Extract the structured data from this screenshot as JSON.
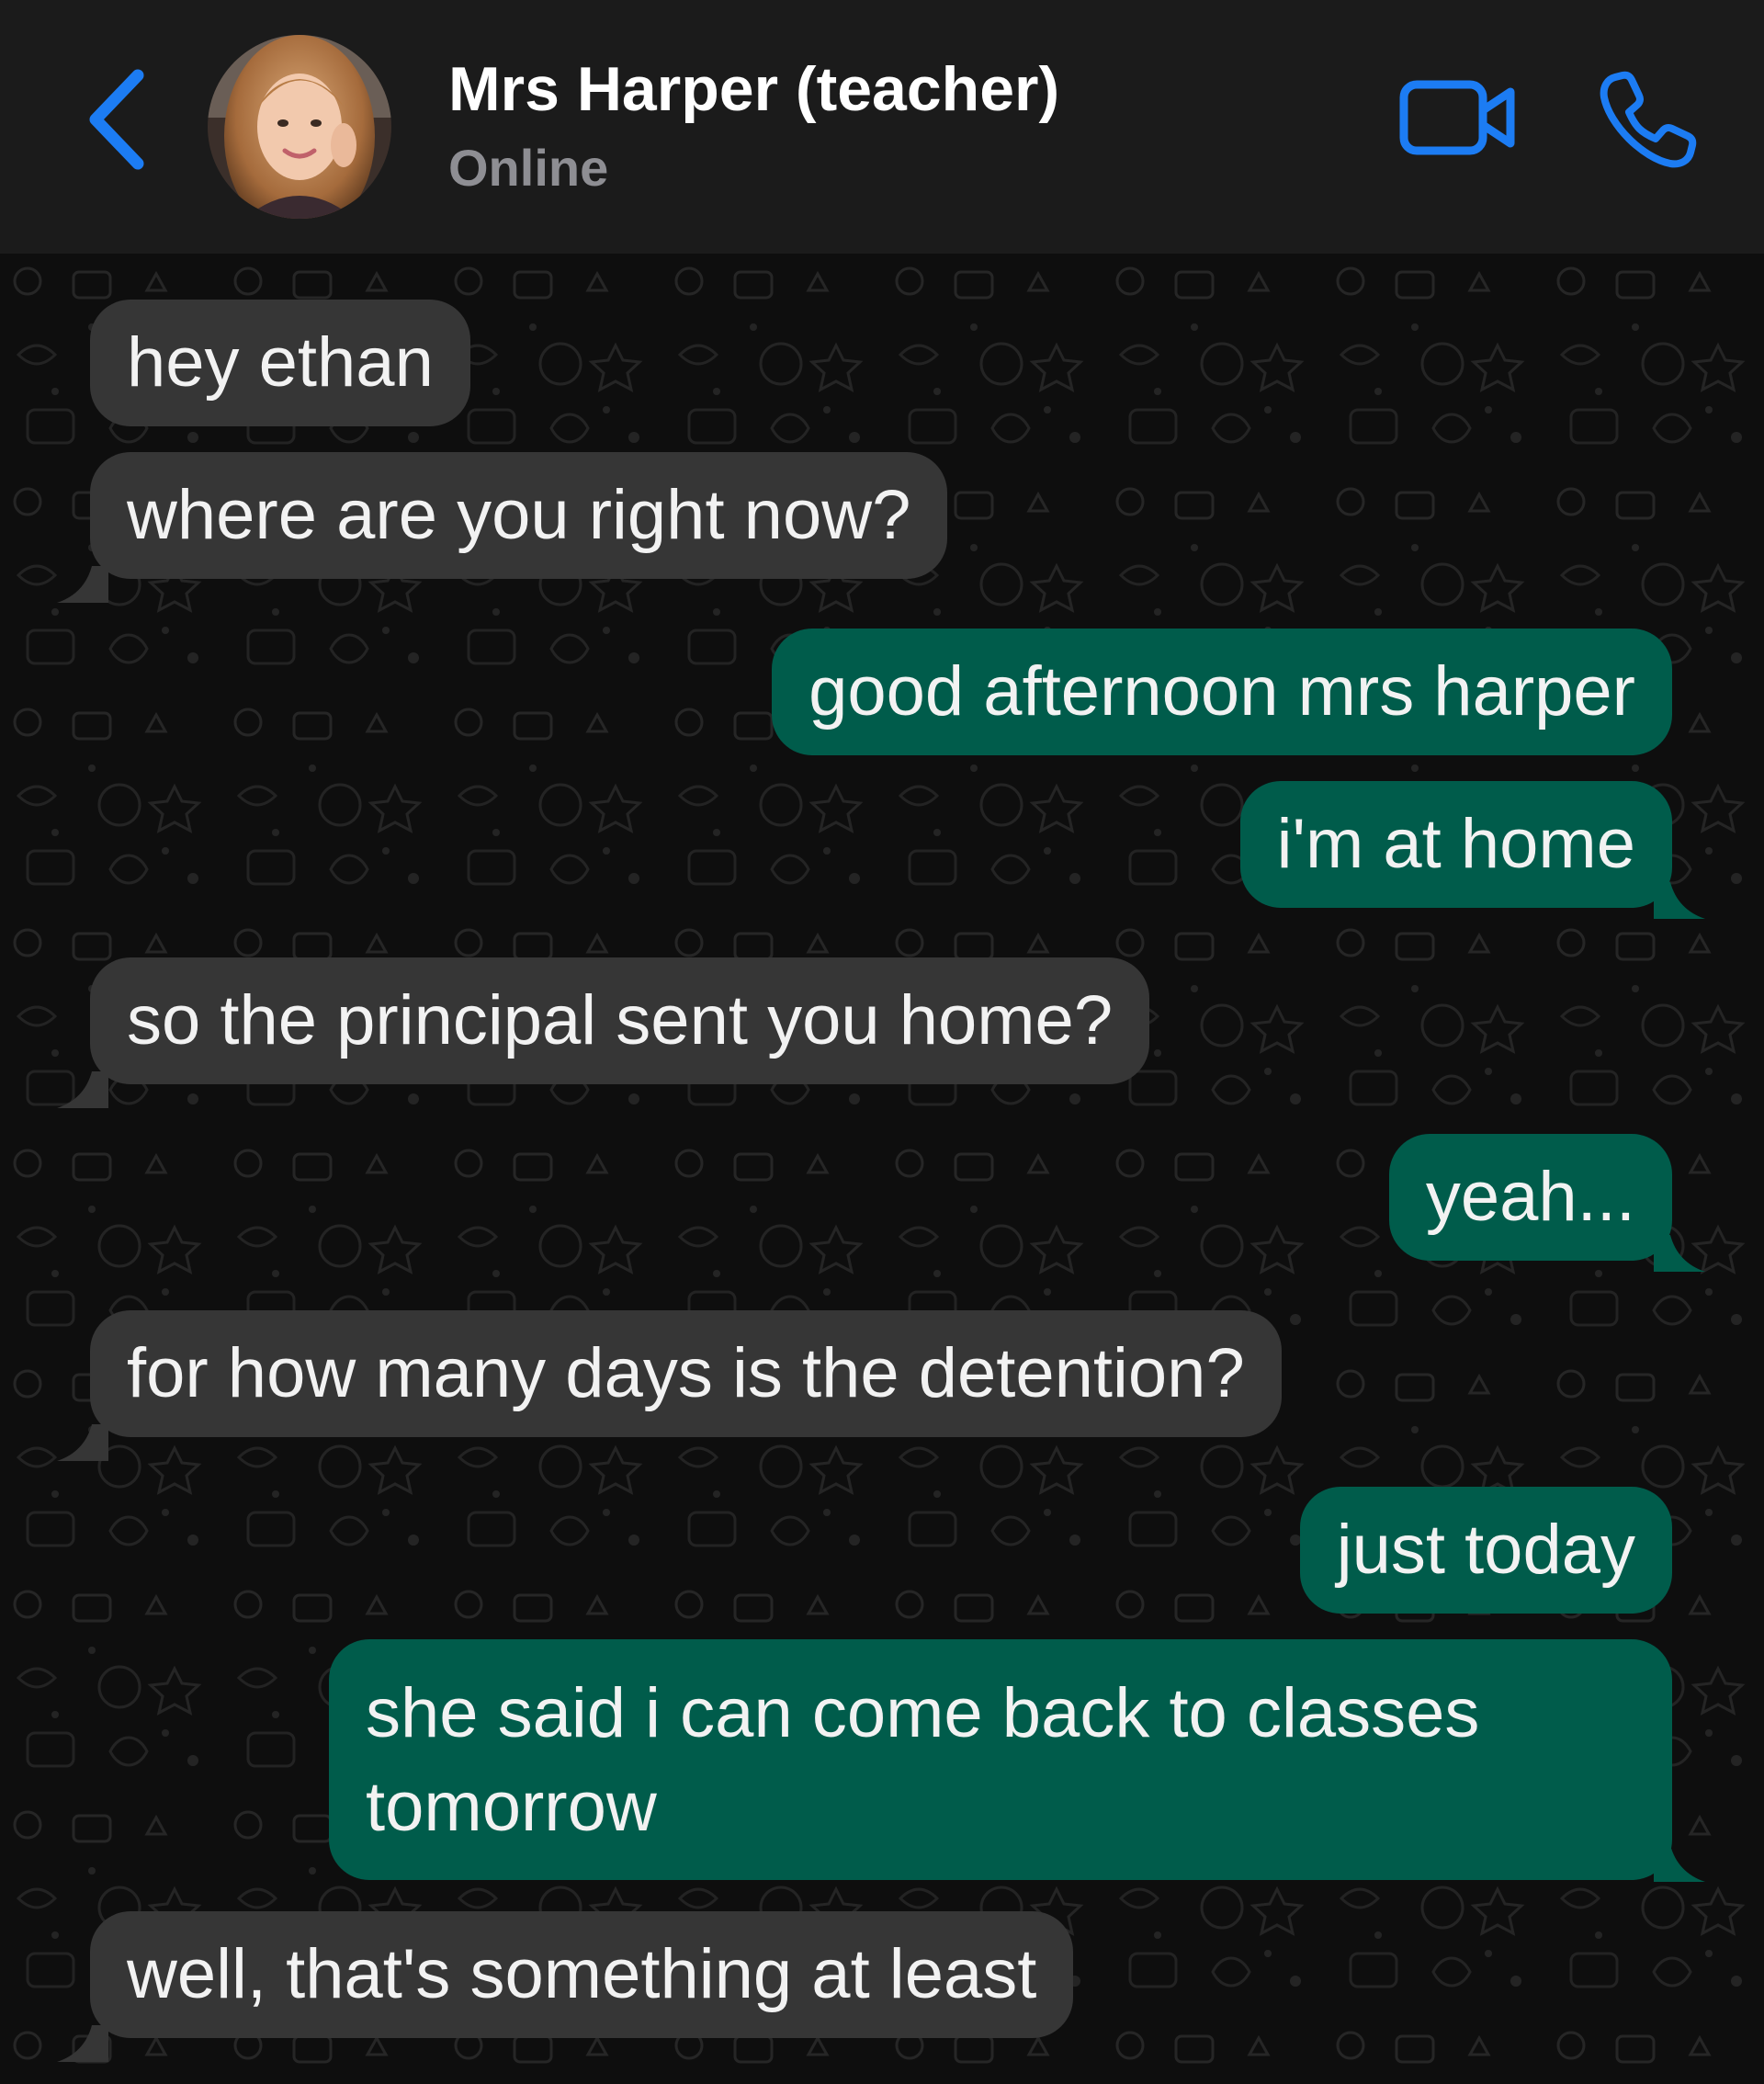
{
  "header": {
    "contact_name": "Mrs Harper (teacher)",
    "status": "Online",
    "accent_color": "#1c7cf3",
    "icons": [
      "chevron-left-icon",
      "video-camera-icon",
      "phone-icon"
    ]
  },
  "messages": [
    {
      "direction": "incoming",
      "text": "hey ethan"
    },
    {
      "direction": "incoming",
      "text": "where are you right now?"
    },
    {
      "direction": "outgoing",
      "text": "good afternoon mrs harper"
    },
    {
      "direction": "outgoing",
      "text": "i'm at home"
    },
    {
      "direction": "incoming",
      "text": "so the principal sent you home?"
    },
    {
      "direction": "outgoing",
      "text": "yeah..."
    },
    {
      "direction": "incoming",
      "text": "for how many days is the detention?"
    },
    {
      "direction": "outgoing",
      "text": "just today"
    },
    {
      "direction": "outgoing",
      "text": "she said i can come back to classes tomorrow"
    },
    {
      "direction": "incoming",
      "text": "well, that's something at least"
    }
  ],
  "colors": {
    "incoming_bubble": "#363636",
    "outgoing_bubble": "#005c4b",
    "header_background": "#1b1b1b",
    "chat_background": "#0e0e0e"
  }
}
